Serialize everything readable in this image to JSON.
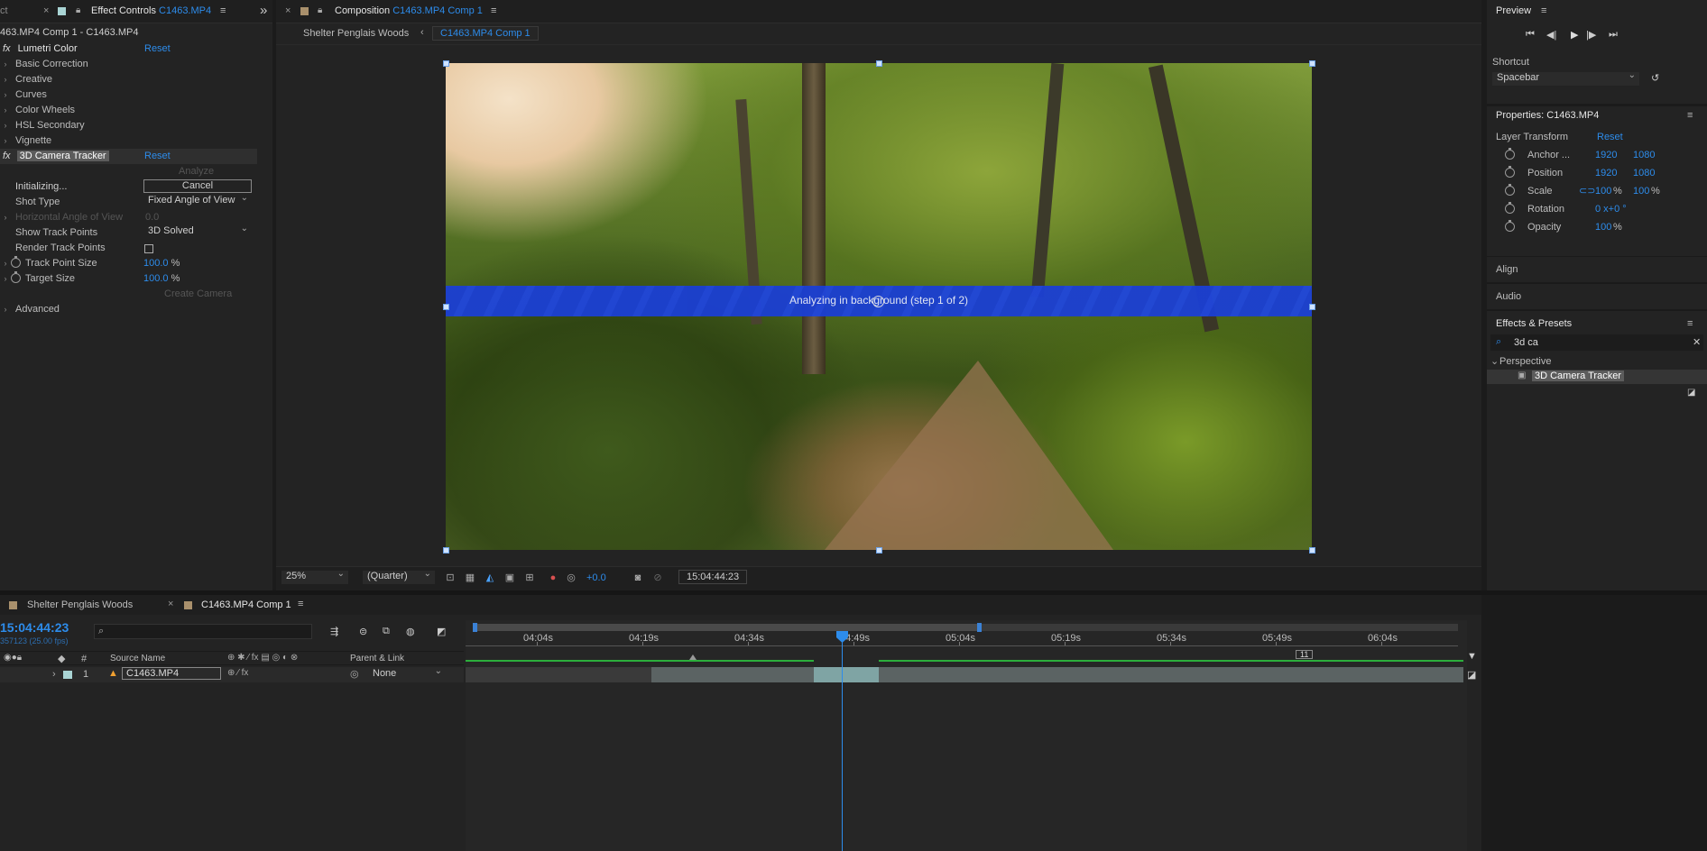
{
  "effect_controls": {
    "close": "×",
    "title": "Effect Controls",
    "layer": "C1463.MP4",
    "breadcrumb": "463.MP4 Comp 1 - C1463.MP4",
    "collapse_icon": "»",
    "lumetri": {
      "name": "Lumetri Color",
      "reset": "Reset"
    },
    "lumetri_groups": [
      "Basic Correction",
      "Creative",
      "Curves",
      "Color Wheels",
      "HSL Secondary",
      "Vignette"
    ],
    "tracker": {
      "name": "3D Camera Tracker",
      "reset": "Reset",
      "analyze": "Analyze",
      "status": "Initializing...",
      "cancel": "Cancel",
      "shot_type_label": "Shot Type",
      "shot_type_value": "Fixed Angle of View",
      "hfov_label": "Horizontal Angle of View",
      "hfov_value": "0.0",
      "show_points_label": "Show Track Points",
      "show_points_value": "3D Solved",
      "render_points_label": "Render Track Points",
      "render_points_checked": false,
      "point_size_label": "Track Point Size",
      "point_size_value": "100.0",
      "percent": "%",
      "target_size_label": "Target Size",
      "target_size_value": "100.0",
      "create_camera": "Create Camera",
      "advanced": "Advanced"
    }
  },
  "composition": {
    "close": "×",
    "title": "Composition",
    "comp_name": "C1463.MP4 Comp 1",
    "crumb_parent": "Shelter Penglais Woods",
    "crumb_current": "C1463.MP4 Comp 1",
    "banner": "Analyzing in background (step 1 of 2)",
    "zoom": "25%",
    "resolution": "(Quarter)",
    "exposure": "+0.0",
    "timecode": "15:04:44:23",
    "accent": "#1c3fd6"
  },
  "timeline": {
    "tabs": [
      "Shelter Penglais Woods",
      "C1463.MP4 Comp 1"
    ],
    "timecode": "15:04:44:23",
    "frames": "357123 (25.00 fps)",
    "search_placeholder": "",
    "col_num": "#",
    "col_source": "Source Name",
    "col_parent": "Parent & Link",
    "layer": {
      "index": "1",
      "name": "C1463.MP4",
      "parent": "None"
    },
    "ruler": [
      "04:04s",
      "04:19s",
      "04:34s",
      "04:49s",
      "05:04s",
      "05:19s",
      "05:34s",
      "05:49s",
      "06:04s"
    ],
    "marker_label": "11"
  },
  "preview": {
    "title": "Preview",
    "shortcut_label": "Shortcut",
    "shortcut_value": "Spacebar"
  },
  "properties": {
    "title": "Properties: C1463.MP4",
    "layer_transform": "Layer Transform",
    "reset": "Reset",
    "rows": [
      {
        "label": "Anchor ...",
        "v1": "1920",
        "v2": "1080"
      },
      {
        "label": "Position",
        "v1": "1920",
        "v2": "1080"
      },
      {
        "label": "Scale",
        "v1": "100",
        "v2": "100",
        "unit": "%"
      },
      {
        "label": "Rotation",
        "v1": "0 x+0 °",
        "v2": ""
      },
      {
        "label": "Opacity",
        "v1": "100",
        "v2": "",
        "unit": "%"
      }
    ]
  },
  "align": {
    "title": "Align"
  },
  "audio": {
    "title": "Audio"
  },
  "effects_presets": {
    "title": "Effects & Presets",
    "search_value": "3d ca",
    "category": "Perspective",
    "item": "3D Camera Tracker"
  }
}
